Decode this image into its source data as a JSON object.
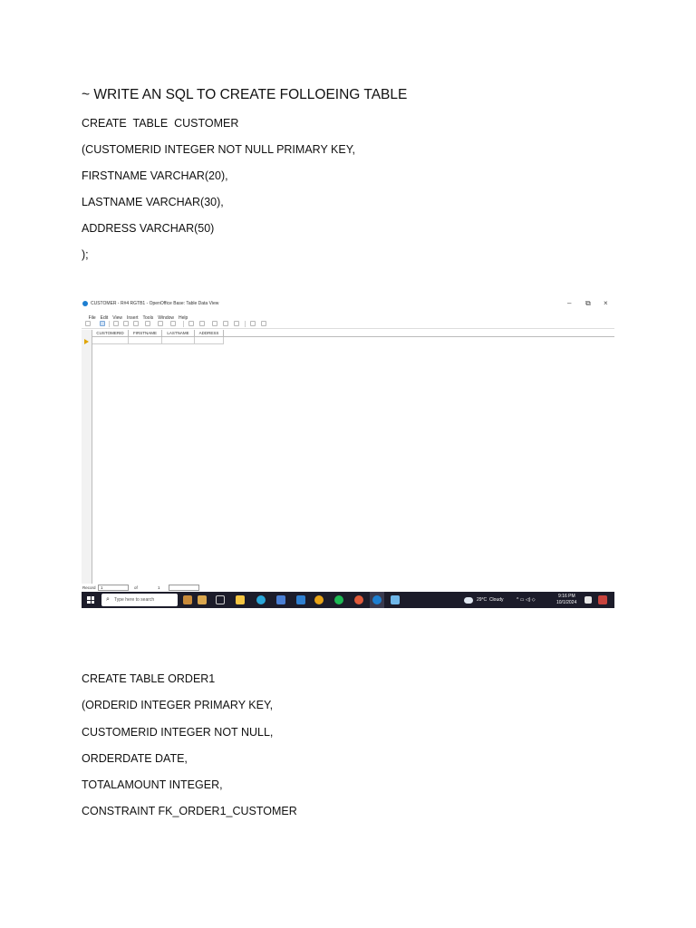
{
  "document": {
    "heading": "~ WRITE AN SQL TO CREATE FOLLOEING TABLE",
    "customer_sql": [
      "CREATE  TABLE  CUSTOMER",
      "(CUSTOMERID INTEGER NOT NULL PRIMARY KEY,",
      "FIRSTNAME VARCHAR(20),",
      "LASTNAME VARCHAR(30),",
      "ADDRESS VARCHAR(50)",
      ");"
    ],
    "order_sql": [
      "CREATE TABLE ORDER1",
      "(ORDERID INTEGER PRIMARY KEY,",
      "CUSTOMERID INTEGER NOT NULL,",
      "ORDERDATE DATE,",
      "TOTALAMOUNT INTEGER,",
      "CONSTRAINT FK_ORDER1_CUSTOMER"
    ]
  },
  "screenshot": {
    "window_title": "CUSTOMER - R#4 RGTB1 - OpenOffice Base: Table Data View",
    "window_controls": {
      "minimize": "–",
      "restore": "⧉",
      "close": "×"
    },
    "menu": [
      "File",
      "Edit",
      "View",
      "Insert",
      "Tools",
      "Window",
      "Help"
    ],
    "columns": [
      "CUSTOMERID",
      "FIRSTNAME",
      "LASTNAME",
      "ADDRESS"
    ],
    "record_bar": {
      "label": "Record",
      "value": "1",
      "of_label": "of",
      "total": "1"
    },
    "taskbar": {
      "search_placeholder": "Type here to search",
      "weather": "29°C  Cloudy",
      "time": "9:16 PM",
      "date": "10/1/2024"
    },
    "icons": [
      "openoffice-icon",
      "windows-start-icon",
      "search-icon",
      "task-view-icon",
      "file-explorer-icon",
      "edge-icon",
      "store-icon",
      "mail-icon",
      "chrome-icon",
      "spotify-icon",
      "chrome-profile-icon",
      "openoffice-taskbar-icon",
      "notepad-icon",
      "weather-icon",
      "notification-icon"
    ],
    "colors": {
      "taskbar": "#1c1c2a",
      "row_marker": "#e0a400",
      "app_accent": "#1d7fd1"
    }
  }
}
